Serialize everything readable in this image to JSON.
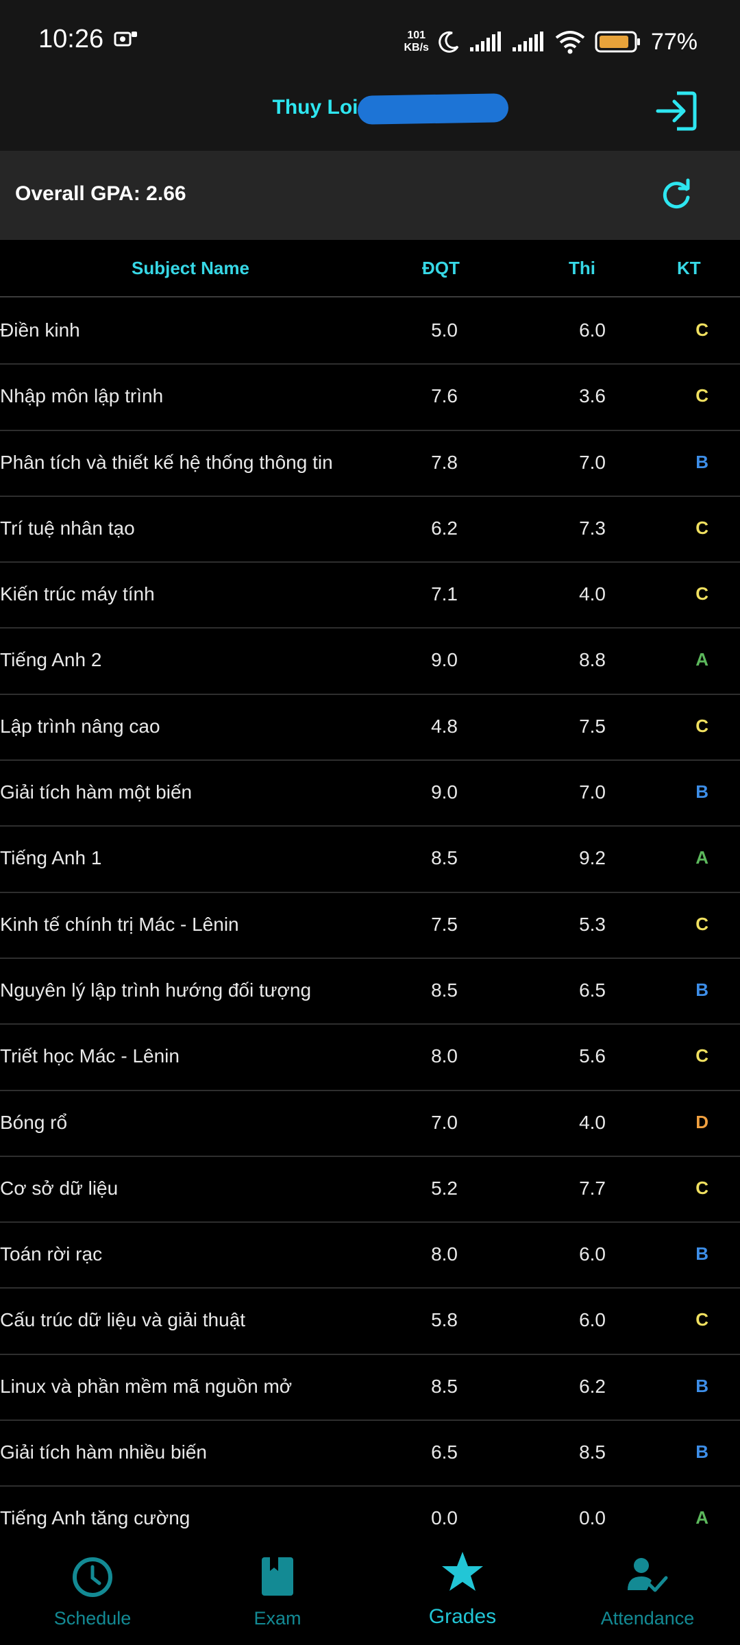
{
  "status_bar": {
    "time": "10:26",
    "net_speed_value": "101",
    "net_speed_unit": "KB/s",
    "battery_percent": "77%"
  },
  "header": {
    "title": "Thuy Loi",
    "logout_icon": "logout-icon"
  },
  "gpa": {
    "text": "Overall GPA: 2.66",
    "refresh_icon": "refresh-icon"
  },
  "table": {
    "headers": {
      "subject": "Subject Name",
      "dqt": "ĐQT",
      "thi": "Thi",
      "kt": "KT"
    },
    "rows": [
      {
        "subject": "Điền kinh",
        "dqt": "5.0",
        "thi": "6.0",
        "kt": "C"
      },
      {
        "subject": "Nhập môn lập trình",
        "dqt": "7.6",
        "thi": "3.6",
        "kt": "C"
      },
      {
        "subject": "Phân tích và thiết kế hệ thống thông tin",
        "dqt": "7.8",
        "thi": "7.0",
        "kt": "B"
      },
      {
        "subject": "Trí tuệ nhân tạo",
        "dqt": "6.2",
        "thi": "7.3",
        "kt": "C"
      },
      {
        "subject": "Kiến trúc máy tính",
        "dqt": "7.1",
        "thi": "4.0",
        "kt": "C"
      },
      {
        "subject": "Tiếng Anh 2",
        "dqt": "9.0",
        "thi": "8.8",
        "kt": "A"
      },
      {
        "subject": "Lập trình nâng cao",
        "dqt": "4.8",
        "thi": "7.5",
        "kt": "C"
      },
      {
        "subject": "Giải tích hàm một biến",
        "dqt": "9.0",
        "thi": "7.0",
        "kt": "B"
      },
      {
        "subject": "Tiếng Anh 1",
        "dqt": "8.5",
        "thi": "9.2",
        "kt": "A"
      },
      {
        "subject": "Kinh tế chính trị Mác - Lênin",
        "dqt": "7.5",
        "thi": "5.3",
        "kt": "C"
      },
      {
        "subject": "Nguyên lý lập trình hướng đối tượng",
        "dqt": "8.5",
        "thi": "6.5",
        "kt": "B"
      },
      {
        "subject": "Triết học Mác - Lênin",
        "dqt": "8.0",
        "thi": "5.6",
        "kt": "C"
      },
      {
        "subject": "Bóng rổ",
        "dqt": "7.0",
        "thi": "4.0",
        "kt": "D"
      },
      {
        "subject": "Cơ sở dữ liệu",
        "dqt": "5.2",
        "thi": "7.7",
        "kt": "C"
      },
      {
        "subject": "Toán rời rạc",
        "dqt": "8.0",
        "thi": "6.0",
        "kt": "B"
      },
      {
        "subject": "Cấu trúc dữ liệu và giải thuật",
        "dqt": "5.8",
        "thi": "6.0",
        "kt": "C"
      },
      {
        "subject": "Linux và phần mềm mã nguồn mở",
        "dqt": "8.5",
        "thi": "6.2",
        "kt": "B"
      },
      {
        "subject": "Giải tích hàm nhiều biến",
        "dqt": "6.5",
        "thi": "8.5",
        "kt": "B"
      },
      {
        "subject": "Tiếng Anh tăng cường",
        "dqt": "0.0",
        "thi": "0.0",
        "kt": "A"
      }
    ]
  },
  "grade_colors": {
    "A": "#5cb85c",
    "B": "#3d8ee8",
    "C": "#f0e060",
    "D": "#f0a040"
  },
  "bottom_nav": [
    {
      "label": "Schedule",
      "icon": "clock-icon",
      "active": false
    },
    {
      "label": "Exam",
      "icon": "book-icon",
      "active": false
    },
    {
      "label": "Grades",
      "icon": "star-icon",
      "active": true
    },
    {
      "label": "Attendance",
      "icon": "person-check-icon",
      "active": false
    }
  ],
  "colors": {
    "accent": "#2ee6f0",
    "nav_inactive": "#138a94",
    "background": "#000000",
    "header_bg": "#161616"
  }
}
